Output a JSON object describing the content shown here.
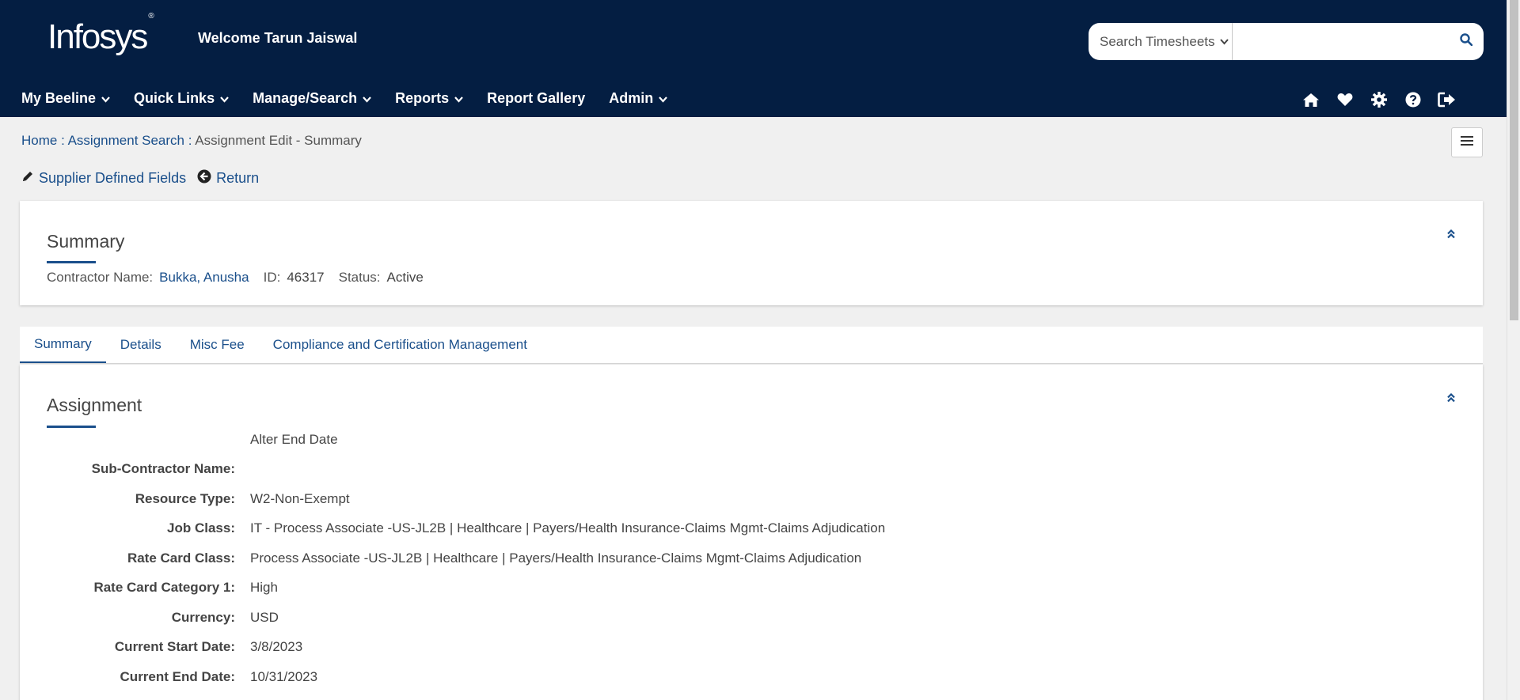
{
  "header": {
    "logo": "Infosys",
    "logo_mark": "®",
    "welcome": "Welcome Tarun Jaiswal",
    "search_select": "Search Timesheets",
    "search_placeholder": ""
  },
  "nav": {
    "items": [
      {
        "label": "My Beeline",
        "has_dropdown": true
      },
      {
        "label": "Quick Links",
        "has_dropdown": true
      },
      {
        "label": "Manage/Search",
        "has_dropdown": true
      },
      {
        "label": "Reports",
        "has_dropdown": true
      },
      {
        "label": "Report Gallery",
        "has_dropdown": false
      },
      {
        "label": "Admin",
        "has_dropdown": true
      }
    ],
    "icons": [
      "home-icon",
      "heart-icon",
      "gear-icon",
      "help-icon",
      "logout-icon"
    ]
  },
  "breadcrumb": {
    "home": "Home",
    "sep1": " : ",
    "assignment_search": "Assignment Search",
    "sep2": " : ",
    "current": "Assignment Edit - Summary"
  },
  "actions": {
    "supplier_fields": "Supplier Defined Fields",
    "return": "Return"
  },
  "summary": {
    "title": "Summary",
    "contractor_label": "Contractor Name:",
    "contractor_name": "Bukka, Anusha",
    "id_label": "ID:",
    "id_value": "46317",
    "status_label": "Status:",
    "status_value": "Active"
  },
  "tabs": [
    {
      "label": "Summary",
      "active": true
    },
    {
      "label": "Details",
      "active": false
    },
    {
      "label": "Misc Fee",
      "active": false
    },
    {
      "label": "Compliance and Certification Management",
      "active": false
    }
  ],
  "assignment": {
    "title": "Assignment",
    "alter_end_date": "Alter End Date",
    "fields": [
      {
        "label": "Sub-Contractor Name:",
        "value": ""
      },
      {
        "label": "Resource Type:",
        "value": "W2-Non-Exempt"
      },
      {
        "label": "Job Class:",
        "value": "IT - Process Associate -US-JL2B | Healthcare | Payers/Health Insurance-Claims Mgmt-Claims Adjudication"
      },
      {
        "label": "Rate Card Class:",
        "value": "Process Associate -US-JL2B | Healthcare | Payers/Health Insurance-Claims Mgmt-Claims Adjudication"
      },
      {
        "label": "Rate Card Category 1:",
        "value": "High"
      },
      {
        "label": "Currency:",
        "value": "USD"
      },
      {
        "label": "Current Start Date:",
        "value": "3/8/2023"
      },
      {
        "label": "Current End Date:",
        "value": "10/31/2023"
      }
    ]
  },
  "colors": {
    "header_bg": "#041e42",
    "link": "#1a4f8b",
    "page_bg": "#f0f0f0"
  }
}
